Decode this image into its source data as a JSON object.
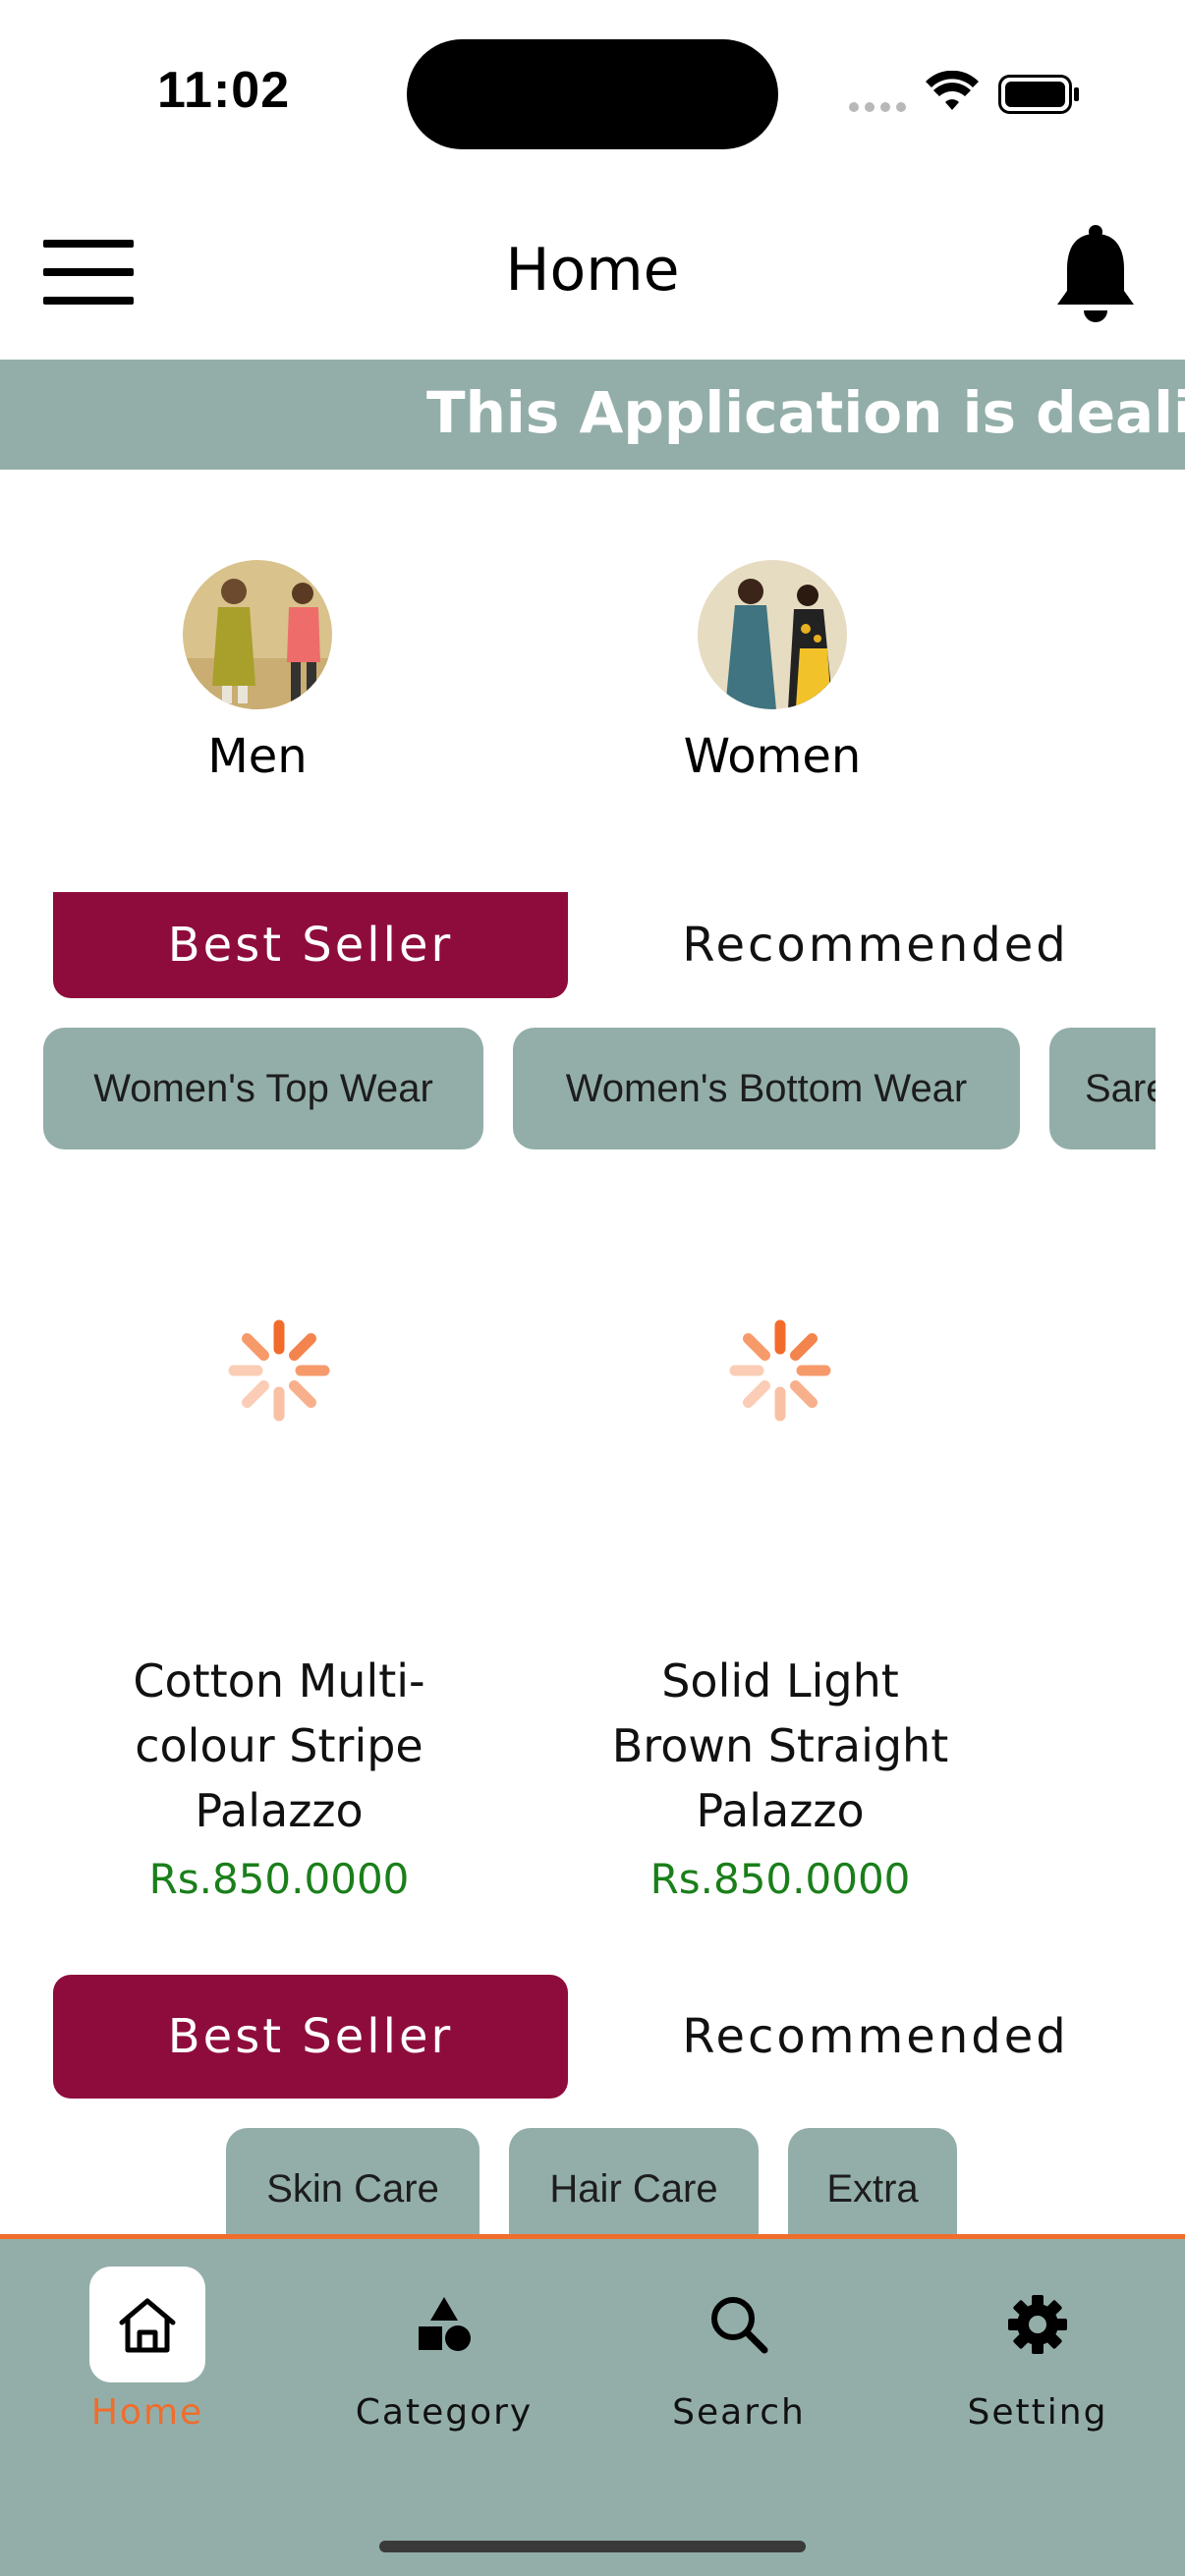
{
  "status_bar": {
    "time": "11:02"
  },
  "header": {
    "title": "Home"
  },
  "announcement": {
    "text": "This Application is dealing"
  },
  "genders": [
    {
      "label": "Men"
    },
    {
      "label": "Women"
    }
  ],
  "tabs_primary": {
    "active": "Best Seller",
    "inactive": "Recommended"
  },
  "chips_primary": [
    "Women's Top Wear",
    "Women's Bottom Wear",
    "Saree"
  ],
  "products": [
    {
      "name_lines": [
        "Cotton Multi-",
        "colour Stripe",
        "Palazzo"
      ],
      "price": "Rs.850.0000"
    },
    {
      "name_lines": [
        "Solid Light",
        "Brown Straight",
        "Palazzo"
      ],
      "price": "Rs.850.0000"
    }
  ],
  "tabs_secondary": {
    "active": "Best Seller",
    "inactive": "Recommended"
  },
  "chips_secondary": [
    "Skin Care",
    "Hair Care",
    "Extra"
  ],
  "bottom_nav": [
    {
      "label": "Home",
      "icon": "home-icon",
      "active": true
    },
    {
      "label": "Category",
      "icon": "category-icon",
      "active": false
    },
    {
      "label": "Search",
      "icon": "search-icon",
      "active": false
    },
    {
      "label": "Setting",
      "icon": "gear-icon",
      "active": false
    }
  ],
  "colors": {
    "accent_teal": "#93aea9",
    "active_tab": "#8e0c3c",
    "nav_active": "#f06d2b",
    "price_green": "#1a7f1a"
  }
}
